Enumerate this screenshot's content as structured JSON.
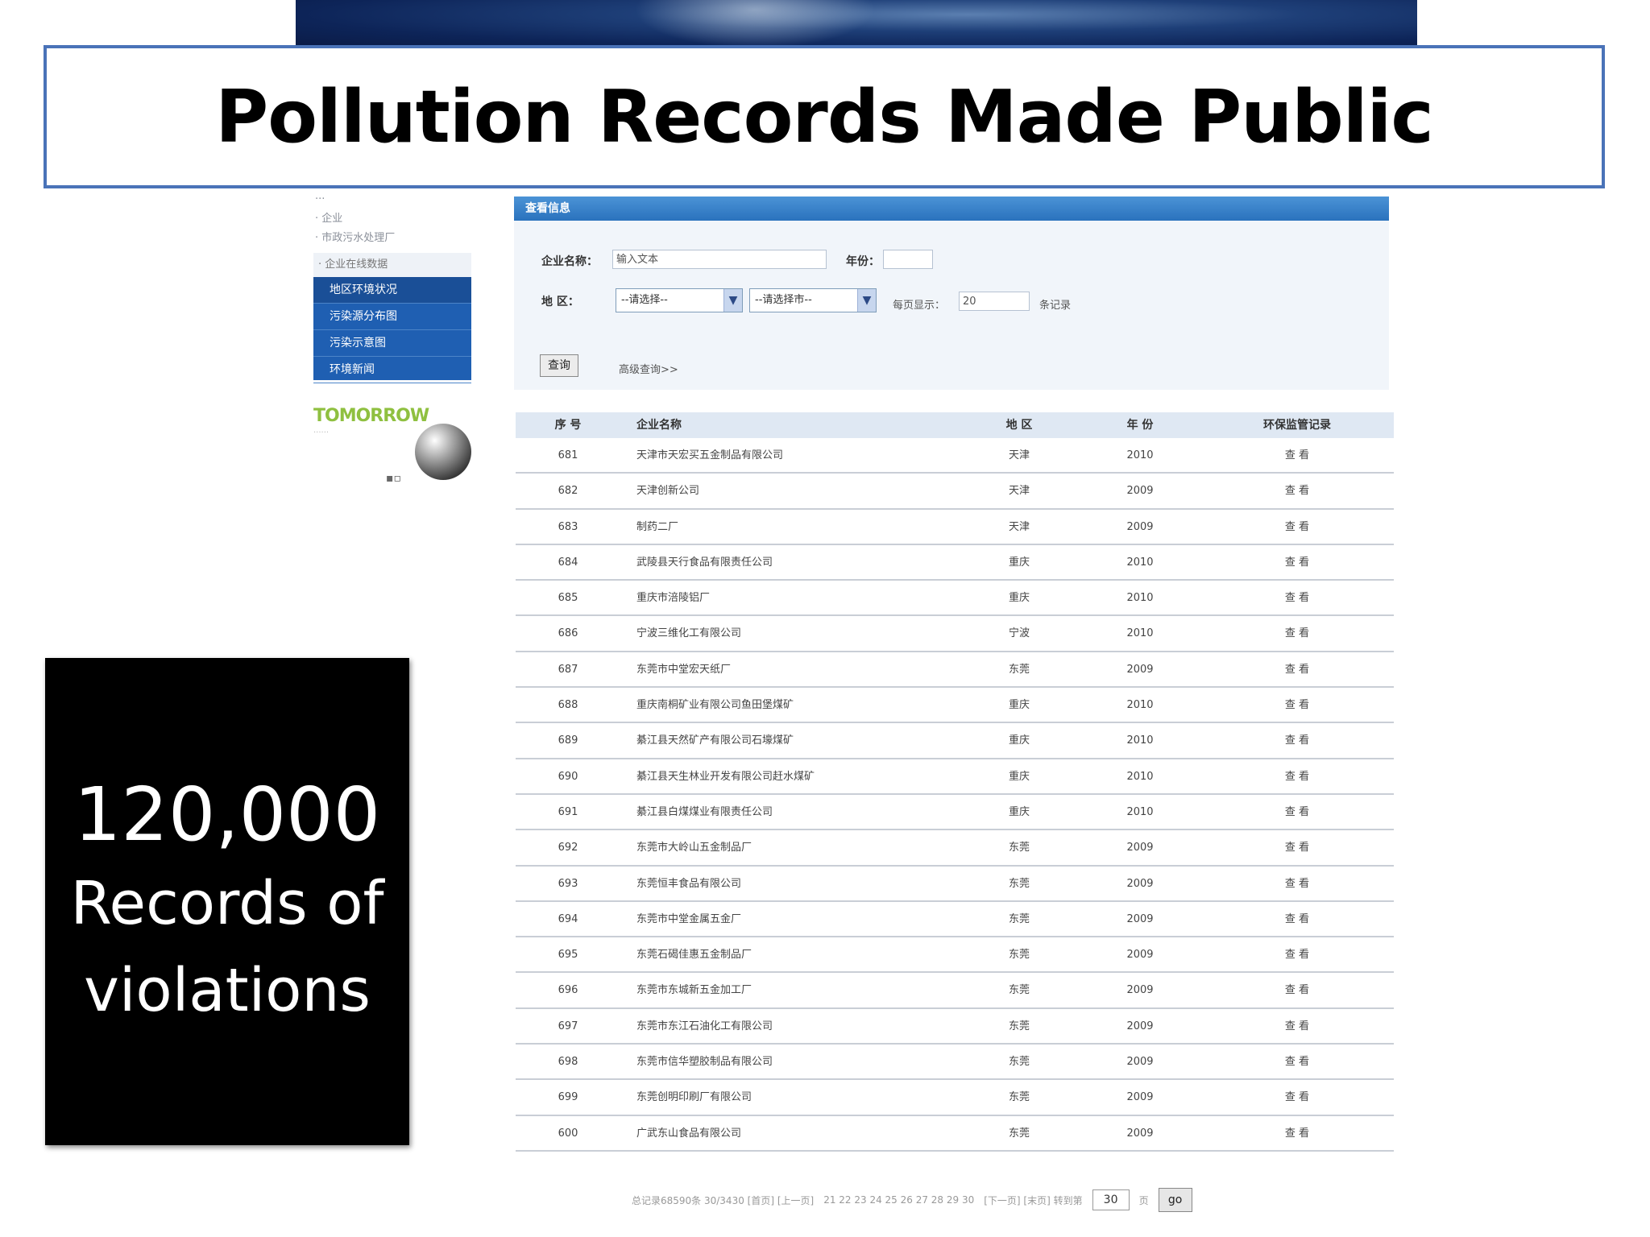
{
  "slide": {
    "title": "Pollution Records Made Public",
    "stat_number": "120,000",
    "stat_line1": "Records of",
    "stat_line2": "violations"
  },
  "sidebar": {
    "top_items": [
      "···",
      "· 企业",
      "· 市政污水处理厂"
    ],
    "section": "· 企业在线数据",
    "items": [
      {
        "label": "地区环境状况"
      },
      {
        "label": "污染源分布图"
      },
      {
        "label": "污染示意图"
      },
      {
        "label": "环境新闻"
      }
    ],
    "logo_text": "TOMORROW",
    "logo_sub": "······"
  },
  "search": {
    "header": "查看信息",
    "company_label": "企业名称：",
    "company_placeholder": "输入文本",
    "year_label": "年份：",
    "region_label": "地 区：",
    "province_select": "--请选择--",
    "city_select": "--请选择市--",
    "per_page_label": "每页显示：",
    "per_page_value": "20",
    "per_page_suffix": "条记录",
    "submit_label": "查询",
    "advanced_link": "高级查询>>"
  },
  "table": {
    "headers": [
      "序 号",
      "企业名称",
      "地 区",
      "年 份",
      "环保监管记录"
    ],
    "rows": [
      {
        "no": "681",
        "name": "天津市天宏买五金制品有限公司",
        "region": "天津",
        "year": "2010",
        "record": "查 看"
      },
      {
        "no": "682",
        "name": "天津创新公司",
        "region": "天津",
        "year": "2009",
        "record": "查 看"
      },
      {
        "no": "683",
        "name": "制药二厂",
        "region": "天津",
        "year": "2009",
        "record": "查 看"
      },
      {
        "no": "684",
        "name": "武陵县天行食品有限责任公司",
        "region": "重庆",
        "year": "2010",
        "record": "查 看"
      },
      {
        "no": "685",
        "name": "重庆市涪陵铝厂",
        "region": "重庆",
        "year": "2010",
        "record": "查 看"
      },
      {
        "no": "686",
        "name": "宁波三维化工有限公司",
        "region": "宁波",
        "year": "2010",
        "record": "查 看"
      },
      {
        "no": "687",
        "name": "东莞市中堂宏天纸厂",
        "region": "东莞",
        "year": "2009",
        "record": "查 看"
      },
      {
        "no": "688",
        "name": "重庆南桐矿业有限公司鱼田堡煤矿",
        "region": "重庆",
        "year": "2010",
        "record": "查 看"
      },
      {
        "no": "689",
        "name": "綦江县天然矿产有限公司石壕煤矿",
        "region": "重庆",
        "year": "2010",
        "record": "查 看"
      },
      {
        "no": "690",
        "name": "綦江县天生林业开发有限公司赶水煤矿",
        "region": "重庆",
        "year": "2010",
        "record": "查 看"
      },
      {
        "no": "691",
        "name": "綦江县白煤煤业有限责任公司",
        "region": "重庆",
        "year": "2010",
        "record": "查 看"
      },
      {
        "no": "692",
        "name": "东莞市大岭山五金制品厂",
        "region": "东莞",
        "year": "2009",
        "record": "查 看"
      },
      {
        "no": "693",
        "name": "东莞恒丰食品有限公司",
        "region": "东莞",
        "year": "2009",
        "record": "查 看"
      },
      {
        "no": "694",
        "name": "东莞市中堂金属五金厂",
        "region": "东莞",
        "year": "2009",
        "record": "查 看"
      },
      {
        "no": "695",
        "name": "东莞石碣佳惠五金制品厂",
        "region": "东莞",
        "year": "2009",
        "record": "查 看"
      },
      {
        "no": "696",
        "name": "东莞市东城新五金加工厂",
        "region": "东莞",
        "year": "2009",
        "record": "查 看"
      },
      {
        "no": "697",
        "name": "东莞市东江石油化工有限公司",
        "region": "东莞",
        "year": "2009",
        "record": "查 看"
      },
      {
        "no": "698",
        "name": "东莞市信华塑胶制品有限公司",
        "region": "东莞",
        "year": "2009",
        "record": "查 看"
      },
      {
        "no": "699",
        "name": "东莞创明印刷厂有限公司",
        "region": "东莞",
        "year": "2009",
        "record": "查 看"
      },
      {
        "no": "600",
        "name": "广武东山食品有限公司",
        "region": "东莞",
        "year": "2009",
        "record": "查 看"
      }
    ]
  },
  "pager": {
    "summary": "总记录68590条 30/3430 [首页] [上一页]",
    "pages": "21 22 23 24 25 26 27 28 29 30",
    "next": "[下一页] [末页] 转到第",
    "page_input": "30",
    "page_suffix": "页",
    "go_label": "go"
  }
}
